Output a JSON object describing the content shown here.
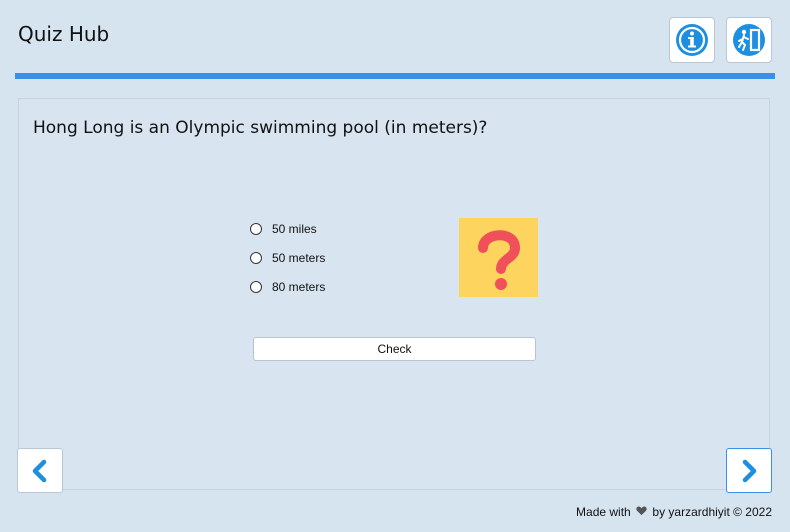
{
  "header": {
    "title": "Quiz Hub",
    "info_icon": "info-icon",
    "exit_icon": "exit-icon",
    "accent_color": "#3a8fe8"
  },
  "quiz": {
    "question": "Hong Long is an Olympic swimming pool (in meters)?",
    "options": [
      "50 miles",
      "50 meters",
      "80 meters"
    ],
    "check_label": "Check",
    "image_icon": "question-mark-icon"
  },
  "nav": {
    "prev_icon": "chevron-left-icon",
    "next_icon": "chevron-right-icon"
  },
  "footer": {
    "text_before": "Made with",
    "heart_icon": "heart-icon",
    "text_after": "by yarzardhiyit © 2022"
  }
}
